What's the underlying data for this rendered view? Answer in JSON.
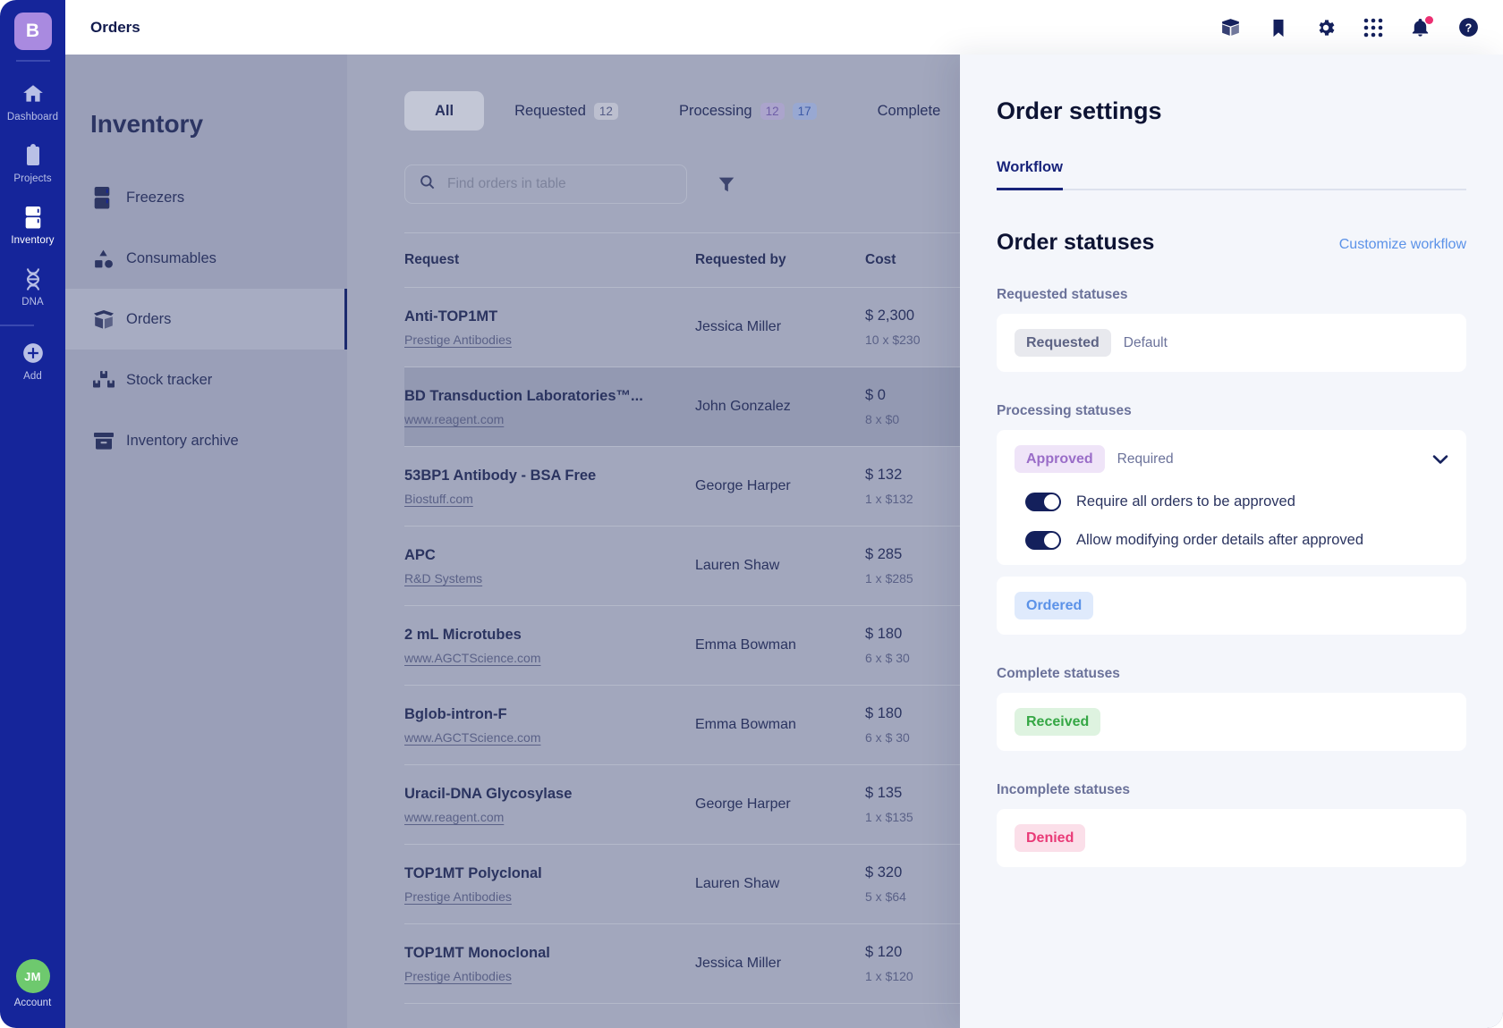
{
  "rail": {
    "logo_initial": "B",
    "items": [
      {
        "label": "Dashboard",
        "icon": "home-icon",
        "active": false
      },
      {
        "label": "Projects",
        "icon": "clipboard-icon",
        "active": false
      },
      {
        "label": "Inventory",
        "icon": "fridge-icon",
        "active": true
      },
      {
        "label": "DNA",
        "icon": "dna-icon",
        "active": false
      },
      {
        "label": "Add",
        "icon": "plus-circle-icon",
        "active": false
      }
    ],
    "account": {
      "initials": "JM",
      "label": "Account"
    }
  },
  "topbar": {
    "title": "Orders",
    "icons": [
      "box-icon",
      "bookmark-icon",
      "gear-icon",
      "apps-grid-icon",
      "bell-icon",
      "help-icon"
    ],
    "notification_dot_color": "#ec2f72"
  },
  "subnav": {
    "title": "Inventory",
    "items": [
      {
        "label": "Freezers",
        "icon": "fridge-icon",
        "active": false
      },
      {
        "label": "Consumables",
        "icon": "shapes-icon",
        "active": false
      },
      {
        "label": "Orders",
        "icon": "open-box-icon",
        "active": true
      },
      {
        "label": "Stock tracker",
        "icon": "boxes-icon",
        "active": false
      },
      {
        "label": "Inventory archive",
        "icon": "archive-icon",
        "active": false
      }
    ]
  },
  "main": {
    "tabs": [
      {
        "label": "All",
        "active": true,
        "badges": []
      },
      {
        "label": "Requested",
        "active": false,
        "badges": [
          {
            "value": "12",
            "color": "gray"
          }
        ]
      },
      {
        "label": "Processing",
        "active": false,
        "badges": [
          {
            "value": "12",
            "color": "purple"
          },
          {
            "value": "17",
            "color": "blue"
          }
        ]
      },
      {
        "label": "Complete",
        "active": false,
        "badges": []
      }
    ],
    "search": {
      "placeholder": "Find orders in table",
      "value": ""
    },
    "filter_label": "Filter",
    "table": {
      "columns": [
        "Request",
        "Requested by",
        "Cost"
      ],
      "rows": [
        {
          "title": "Anti-TOP1MT",
          "vendor": "Prestige Antibodies",
          "requested_by": "Jessica Miller",
          "cost": "$ 2,300",
          "qty": "10 x $230",
          "selected": false
        },
        {
          "title": "BD Transduction Laboratories™...",
          "vendor": "www.reagent.com",
          "requested_by": "John Gonzalez",
          "cost": "$ 0",
          "qty": "8 x $0",
          "selected": true
        },
        {
          "title": "53BP1 Antibody - BSA Free",
          "vendor": "Biostuff.com",
          "requested_by": "George Harper",
          "cost": "$ 132",
          "qty": "1 x $132",
          "selected": false
        },
        {
          "title": "APC",
          "vendor": "R&D Systems",
          "requested_by": "Lauren Shaw",
          "cost": "$ 285",
          "qty": "1 x $285",
          "selected": false
        },
        {
          "title": "2 mL Microtubes",
          "vendor": "www.AGCTScience.com",
          "requested_by": "Emma Bowman",
          "cost": "$ 180",
          "qty": "6 x $ 30",
          "selected": false
        },
        {
          "title": "Bglob-intron-F",
          "vendor": "www.AGCTScience.com",
          "requested_by": "Emma Bowman",
          "cost": "$ 180",
          "qty": "6 x $ 30",
          "selected": false
        },
        {
          "title": "Uracil-DNA Glycosylase",
          "vendor": "www.reagent.com",
          "requested_by": "George Harper",
          "cost": "$ 135",
          "qty": "1 x $135",
          "selected": false
        },
        {
          "title": "TOP1MT Polyclonal",
          "vendor": "Prestige Antibodies",
          "requested_by": "Lauren Shaw",
          "cost": "$ 320",
          "qty": "5 x $64",
          "selected": false
        },
        {
          "title": "TOP1MT Monoclonal",
          "vendor": "Prestige Antibodies",
          "requested_by": "Jessica Miller",
          "cost": "$ 120",
          "qty": "1 x $120",
          "selected": false
        }
      ]
    }
  },
  "panel": {
    "title": "Order settings",
    "tab": "Workflow",
    "section_title": "Order statuses",
    "customize_link": "Customize workflow",
    "groups": [
      {
        "label": "Requested statuses",
        "cards": [
          {
            "chip": "Requested",
            "chip_color": "gray",
            "note": "Default",
            "chevron": false,
            "toggles": []
          }
        ]
      },
      {
        "label": "Processing statuses",
        "cards": [
          {
            "chip": "Approved",
            "chip_color": "purple",
            "note": "Required",
            "chevron": true,
            "toggles": [
              {
                "label": "Require all orders to be approved",
                "on": true
              },
              {
                "label": "Allow modifying order details after approved",
                "on": true
              }
            ]
          },
          {
            "chip": "Ordered",
            "chip_color": "blue",
            "note": "",
            "chevron": false,
            "toggles": []
          }
        ]
      },
      {
        "label": "Complete statuses",
        "cards": [
          {
            "chip": "Received",
            "chip_color": "green",
            "note": "",
            "chevron": false,
            "toggles": []
          }
        ]
      },
      {
        "label": "Incomplete statuses",
        "cards": [
          {
            "chip": "Denied",
            "chip_color": "pink",
            "note": "",
            "chevron": false,
            "toggles": []
          }
        ]
      }
    ]
  }
}
